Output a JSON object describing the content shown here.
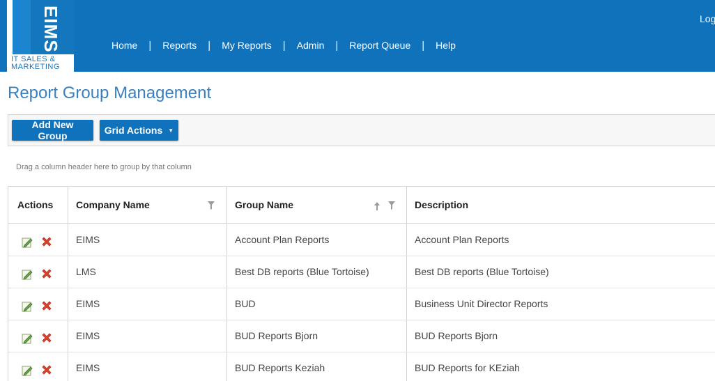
{
  "logo": {
    "name": "EIMS",
    "subtitle_line1": "IT SALES &",
    "subtitle_line2": "MARKETING"
  },
  "nav": {
    "items": [
      "Home",
      "Reports",
      "My Reports",
      "Admin",
      "Report Queue",
      "Help"
    ],
    "login_label": "Log"
  },
  "page": {
    "title": "Report Group Management"
  },
  "toolbar": {
    "add_label": "Add New Group",
    "grid_actions_label": "Grid Actions"
  },
  "grid": {
    "group_hint": "Drag a column header here to group by that column",
    "columns": [
      "Actions",
      "Company Name",
      "Group Name",
      "Description"
    ],
    "rows": [
      {
        "company": "EIMS",
        "group": "Account Plan Reports",
        "description": "Account Plan Reports"
      },
      {
        "company": "LMS",
        "group": "Best DB reports (Blue Tortoise)",
        "description": "Best DB reports (Blue Tortoise)"
      },
      {
        "company": "EIMS",
        "group": "BUD",
        "description": "Business Unit Director Reports"
      },
      {
        "company": "EIMS",
        "group": "BUD Reports Bjorn",
        "description": "BUD Reports Bjorn"
      },
      {
        "company": "EIMS",
        "group": "BUD Reports Keziah",
        "description": "BUD Reports for KEziah"
      }
    ]
  },
  "colors": {
    "brand_blue": "#0f72bb",
    "title_blue": "#3b7fbe",
    "delete_red": "#e0412c"
  },
  "icons": {
    "edit": "edit-icon",
    "delete": "delete-icon",
    "filter": "filter-icon",
    "sort": "sort-ascending-icon"
  }
}
